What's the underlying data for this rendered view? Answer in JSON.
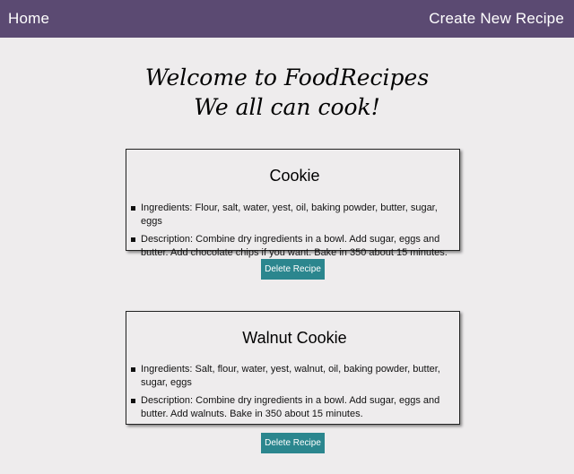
{
  "nav": {
    "home_label": "Home",
    "create_label": "Create New Recipe",
    "background": "#5b4a72"
  },
  "welcome": {
    "line1": "Welcome to FoodRecipes",
    "line2": "We all can cook!"
  },
  "recipes": [
    {
      "title": "Cookie",
      "ingredients": "Ingredients: Flour, salt, water, yest, oil, baking powder, butter, sugar, eggs",
      "description": "Description: Combine dry ingredients in a bowl. Add sugar, eggs and butter. Add chocolate chips if you want. Bake in 350 about 15 minutes.",
      "delete_label": "Delete Recipe"
    },
    {
      "title": "Walnut Cookie",
      "ingredients": "Ingredients: Salt, flour, water, yest, walnut, oil, baking powder, butter, sugar, eggs",
      "description": "Description: Combine dry ingredients in a bowl. Add sugar, eggs and butter. Add walnuts. Bake in 350 about 15 minutes.",
      "delete_label": "Delete Recipe"
    }
  ],
  "colors": {
    "page_background": "#eeeced",
    "button_background": "#2b868e"
  }
}
